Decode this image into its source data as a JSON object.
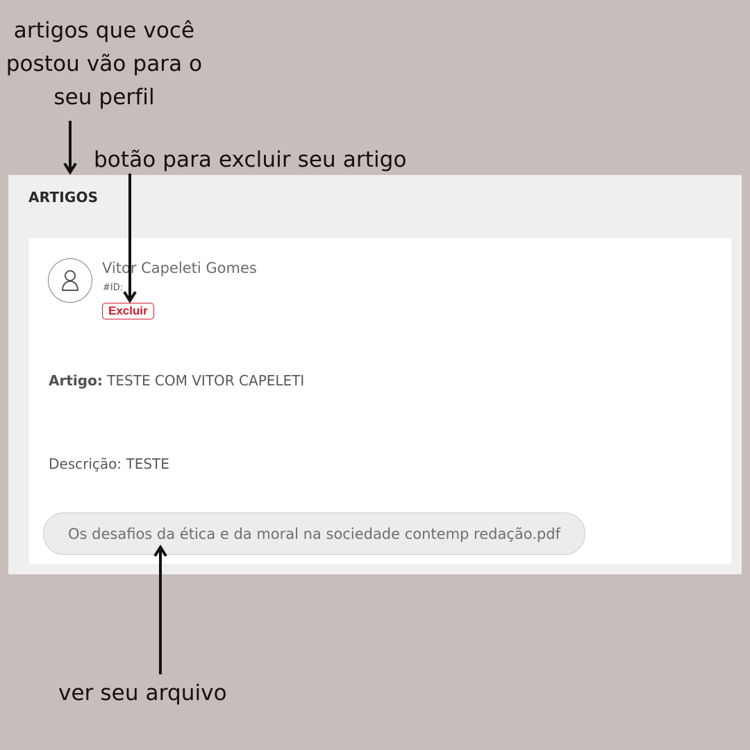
{
  "annotations": {
    "profile_note": "artigos que você\npostou vão para o\nseu perfil",
    "delete_note": "botão para excluir seu artigo",
    "file_note": "ver seu arquivo"
  },
  "section": {
    "title": "ARTIGOS"
  },
  "article": {
    "author_name": "Vitor Capeleti Gomes",
    "author_id": "#ID:",
    "delete_label": "Excluir",
    "article_label": "Artigo:",
    "article_title": "TESTE COM VITOR CAPELETI",
    "description": "Descrição: TESTE",
    "file_name": "Os desafios da ética e da moral na sociedade contemp redação.pdf"
  },
  "icons": {
    "avatar": "user-icon",
    "arrows": "arrow-icon"
  },
  "colors": {
    "page_background": "#c7bdbb",
    "panel_background": "#efefef",
    "card_background": "#ffffff",
    "delete_accent": "#d11b2c",
    "file_pill_background": "#ececec"
  }
}
